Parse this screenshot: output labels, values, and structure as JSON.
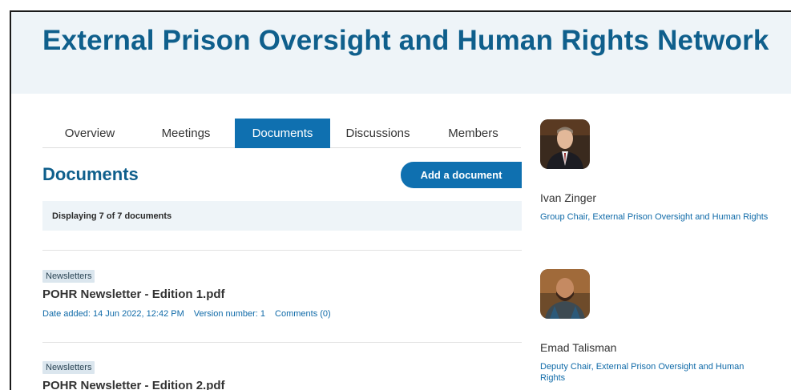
{
  "header": {
    "title": "External Prison Oversight and Human Rights Network"
  },
  "tabs": [
    {
      "label": "Overview"
    },
    {
      "label": "Meetings"
    },
    {
      "label": "Documents",
      "active": true
    },
    {
      "label": "Discussions"
    },
    {
      "label": "Members"
    }
  ],
  "documents": {
    "heading": "Documents",
    "add_button": "Add a document",
    "display_text": "Displaying 7 of 7 documents",
    "items": [
      {
        "tag": "Newsletters",
        "title": "POHR Newsletter - Edition 1.pdf",
        "date": "Date added: 14 Jun 2022, 12:42 PM",
        "version": "Version number: 1",
        "comments": "Comments (0)"
      },
      {
        "tag": "Newsletters",
        "title": "POHR Newsletter - Edition 2.pdf"
      }
    ]
  },
  "people": [
    {
      "name": "Ivan Zinger",
      "role": "Group Chair, External Prison Oversight and Human Rights"
    },
    {
      "name": "Emad Talisman",
      "role": "Deputy Chair, External Prison Oversight and Human Rights"
    }
  ],
  "colors": {
    "brand": "#0f5f8c",
    "accent": "#0f70b0",
    "banner_bg": "#eef4f8",
    "tag_bg": "#dbe6ee"
  }
}
